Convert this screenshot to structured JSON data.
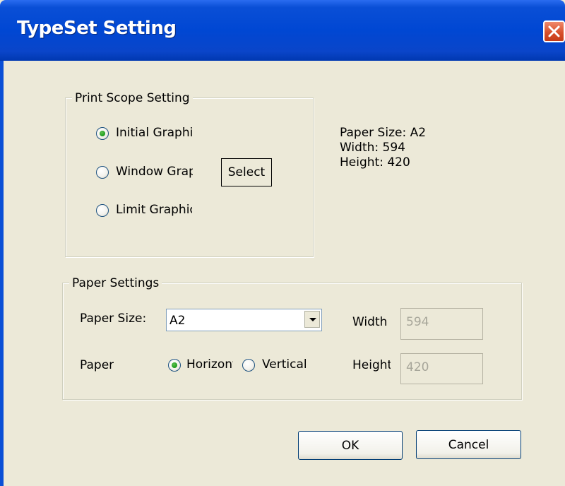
{
  "window": {
    "title": "TypeSet Setting"
  },
  "print_scope": {
    "legend": "Print Scope Setting",
    "options": [
      {
        "label": "Initial Graphic",
        "checked": true
      },
      {
        "label": "Window Graphic",
        "checked": false
      },
      {
        "label": "Limit Graphic",
        "checked": false
      }
    ],
    "select_label": "Select"
  },
  "info": {
    "paper_size": "Paper Size: A2",
    "width": "Width: 594",
    "height": "Height: 420"
  },
  "paper_settings": {
    "legend": "Paper Settings",
    "paper_size_label": "Paper Size:",
    "paper_size_value": "A2",
    "orientation_label": "Paper",
    "horizontal_label": "Horizontal",
    "horizontal_checked": true,
    "vertical_label": "Vertical",
    "vertical_checked": false,
    "width_label": "Width",
    "width_value": "594",
    "height_label": "Height",
    "height_value": "420"
  },
  "buttons": {
    "ok": "OK",
    "cancel": "Cancel"
  },
  "icons": {
    "close": "close-icon",
    "dropdown": "chevron-down-icon"
  },
  "colors": {
    "titlebar": "#0047d3",
    "close_button": "#d8512d",
    "dialog_bg": "#ece9d8"
  }
}
